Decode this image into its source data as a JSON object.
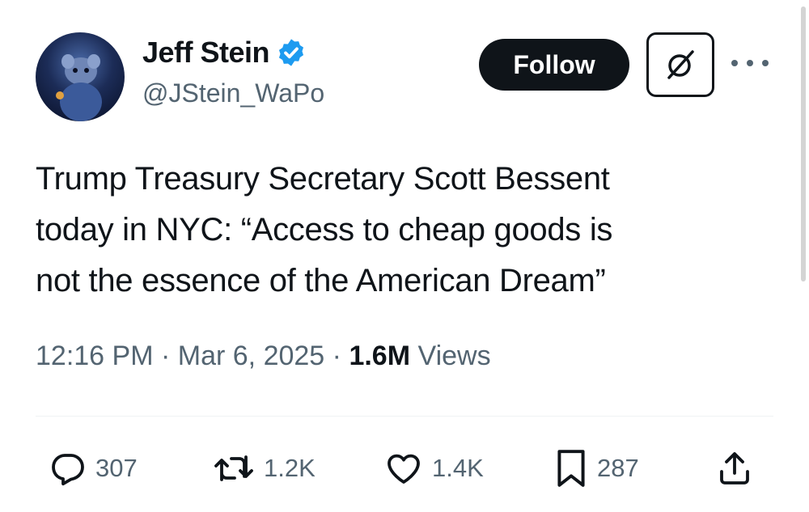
{
  "author": {
    "name": "Jeff Stein",
    "handle": "@JStein_WaPo",
    "verified": true
  },
  "actions_header": {
    "follow_label": "Follow"
  },
  "tweet": {
    "lines": [
      "Trump Treasury Secretary Scott Bessent",
      "today in NYC: “Access to cheap goods is",
      "not the essence of the American Dream”"
    ]
  },
  "meta": {
    "time": "12:16 PM",
    "separator": "·",
    "date": "Mar 6, 2025",
    "views_count": "1.6M",
    "views_label": "Views"
  },
  "stats": {
    "replies": "307",
    "reposts": "1.2K",
    "likes": "1.4K",
    "bookmarks": "287"
  },
  "icons": {
    "avatar": "avatar-image",
    "verified": "verified-badge-icon",
    "grok": "grok-icon",
    "more": "more-dots-icon",
    "reply": "reply-icon",
    "repost": "repost-icon",
    "like": "heart-icon",
    "bookmark": "bookmark-icon",
    "share": "share-icon"
  },
  "colors": {
    "text": "#0f1419",
    "secondary": "#536471",
    "verified_blue": "#1d9bf0",
    "follow_bg": "#0f1419",
    "divider": "#eff3f4"
  }
}
